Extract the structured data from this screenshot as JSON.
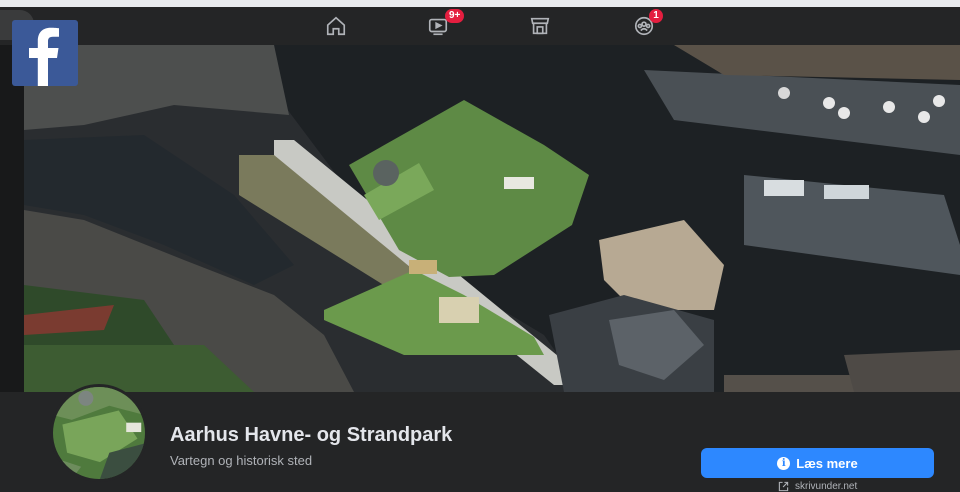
{
  "nav": {
    "tabs": [
      {
        "icon": "home-icon"
      },
      {
        "icon": "watch-icon",
        "badge": "9+"
      },
      {
        "icon": "marketplace-icon"
      },
      {
        "icon": "groups-icon",
        "badge": "1"
      }
    ]
  },
  "logo": {
    "letter": "f",
    "color": "#3b5998"
  },
  "page": {
    "name": "Aarhus Havne- og Strandpark",
    "category": "Vartegn og historisk sted"
  },
  "actions": {
    "primary_label": "Læs mere",
    "primary_icon": "info-icon",
    "accent": "#2d88ff"
  },
  "watermark": {
    "text": "skrivunder.net",
    "icon": "external-link-icon"
  }
}
